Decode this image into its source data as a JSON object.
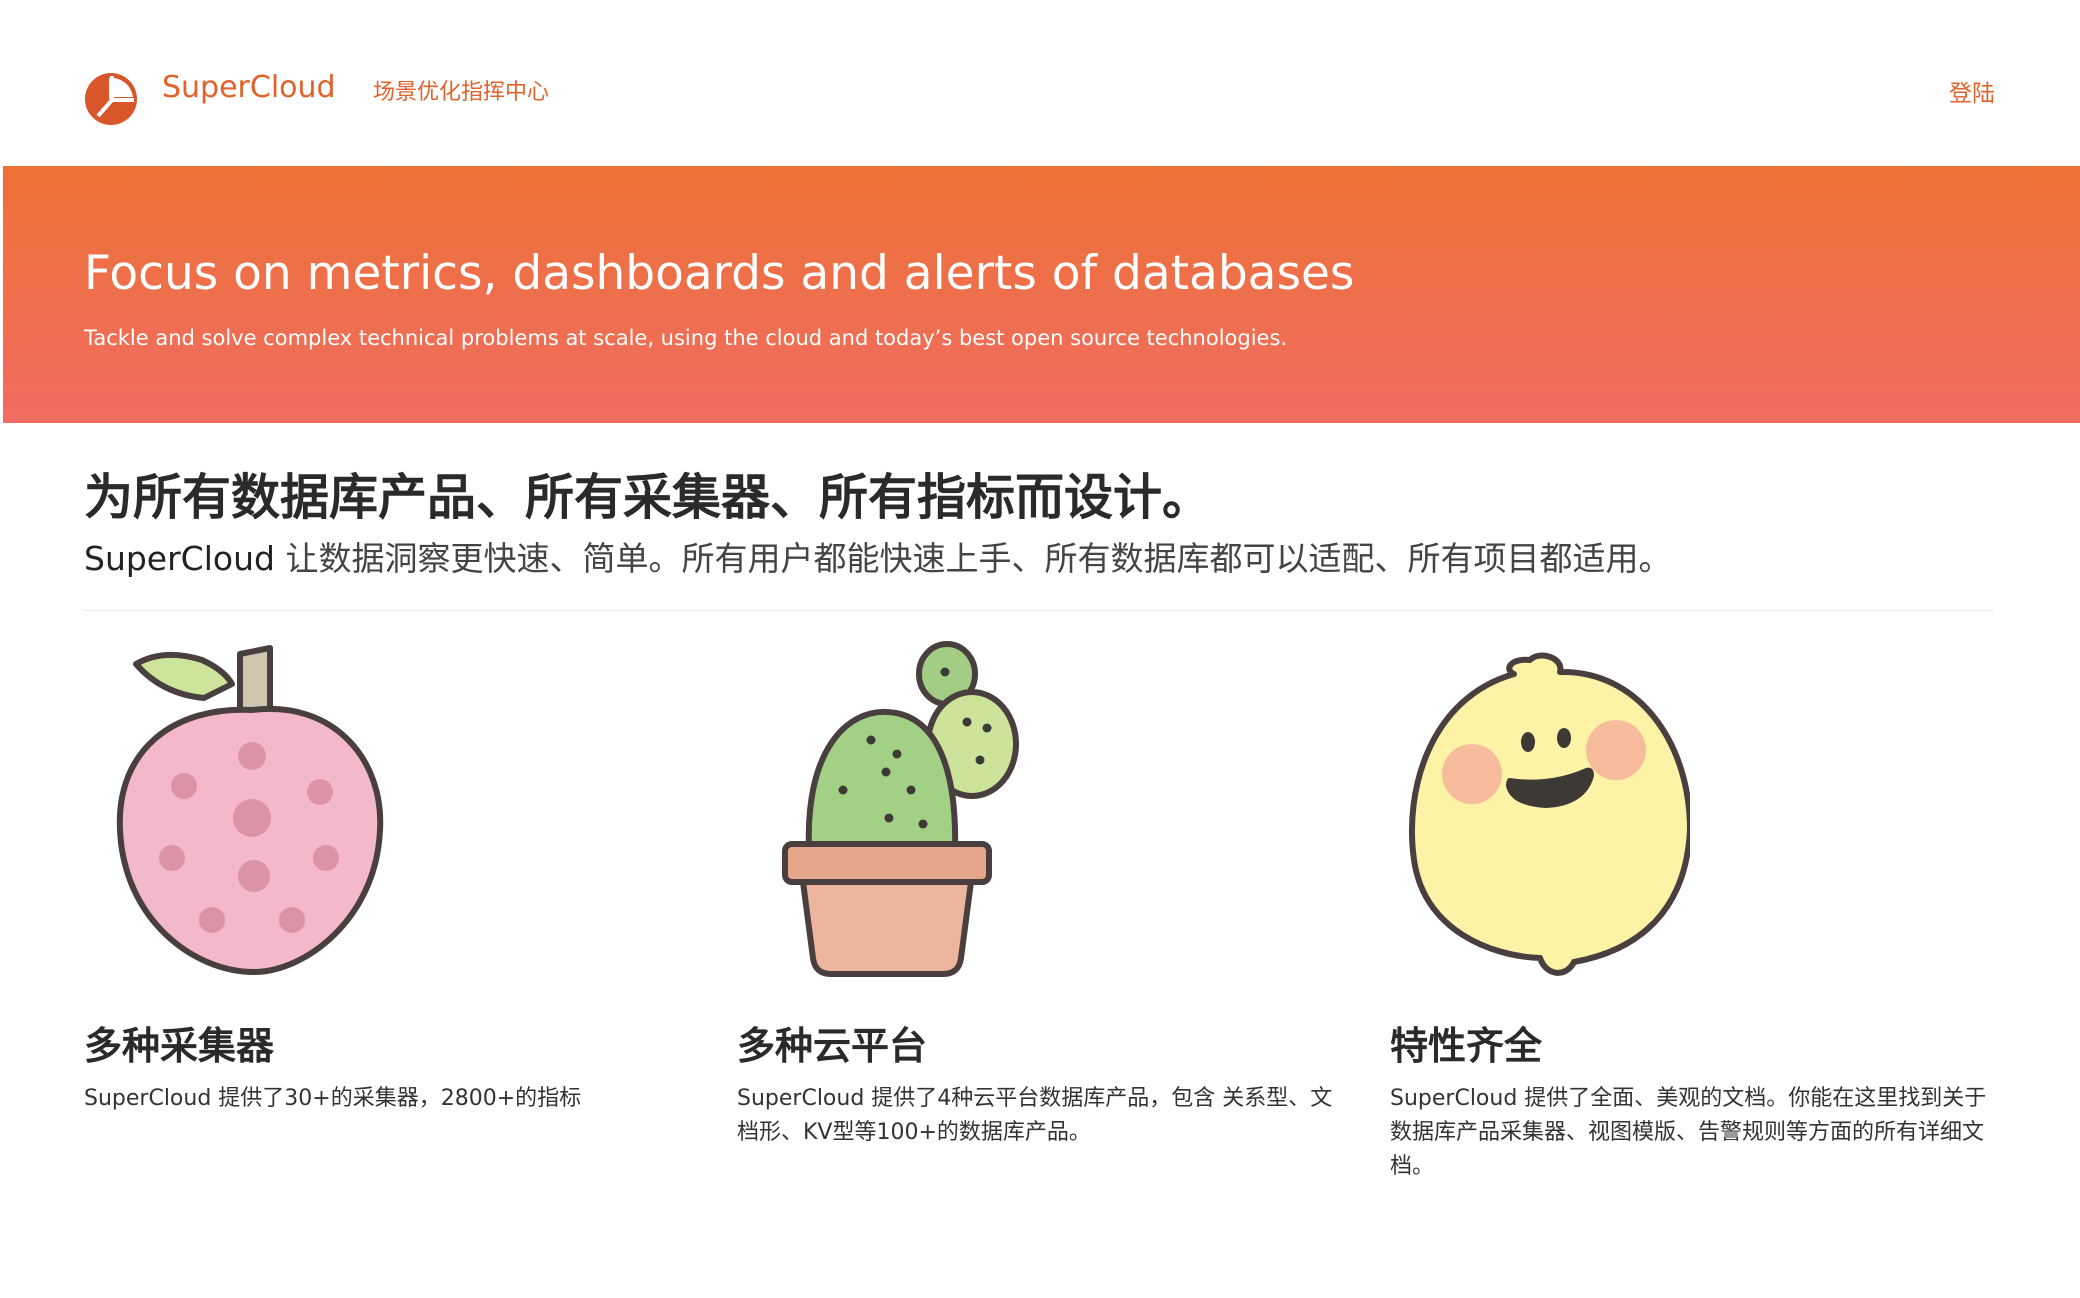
{
  "header": {
    "brand": "SuperCloud",
    "nav_link": "场景优化指挥中心",
    "login": "登陆",
    "logo_icon": "pie-chart-logo-icon",
    "accent_color": "#e2622b"
  },
  "hero": {
    "title": "Focus on metrics, dashboards and alerts of databases",
    "subtitle": "Tackle and solve complex technical problems at scale, using the cloud and today’s best open source technologies.",
    "gradient_top": "#ec7135",
    "gradient_bottom": "#f06d62"
  },
  "intro": {
    "heading": "为所有数据库产品、所有采集器、所有指标而设计。",
    "text_brand": "SuperCloud",
    "text_rest": " 让数据洞察更快速、简单。所有用户都能快速上手、所有数据库都可以适配、所有项目都适用。"
  },
  "features": [
    {
      "icon": "strawberry-icon",
      "title": "多种采集器",
      "desc": "SuperCloud 提供了30+的采集器，2800+的指标"
    },
    {
      "icon": "cactus-icon",
      "title": "多种云平台",
      "desc": "SuperCloud 提供了4种云平台数据库产品，包含 关系型、文档形、KV型等100+的数据库产品。"
    },
    {
      "icon": "smiling-lemon-icon",
      "title": "特性齐全",
      "desc": "SuperCloud 提供了全面、美观的文档。你能在这里找到关于 数据库产品采集器、视图模版、告警规则等方面的所有详细文档。"
    }
  ]
}
